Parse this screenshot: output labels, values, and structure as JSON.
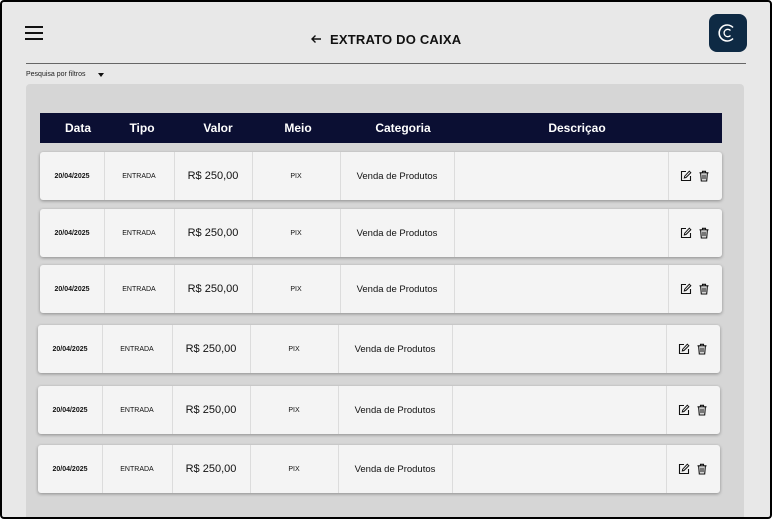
{
  "header": {
    "title": "EXTRATO DO CAIXA",
    "menu_icon": "hamburger-menu-icon",
    "back_icon": "arrow-left-icon",
    "logo_color": "#0e2a44"
  },
  "filter": {
    "label": "Pesquisa por filtros",
    "icon": "caret-down-icon"
  },
  "table": {
    "header_color": "#0b0f33",
    "columns": [
      "Data",
      "Tipo",
      "Valor",
      "Meio",
      "Categoria",
      "Descriçao"
    ],
    "rows": [
      {
        "data": "20/04/2025",
        "tipo": "ENTRADA",
        "valor": "R$ 250,00",
        "meio": "PIX",
        "categoria": "Venda de Produtos",
        "descricao": ""
      },
      {
        "data": "20/04/2025",
        "tipo": "ENTRADA",
        "valor": "R$ 250,00",
        "meio": "PIX",
        "categoria": "Venda de Produtos",
        "descricao": ""
      },
      {
        "data": "20/04/2025",
        "tipo": "ENTRADA",
        "valor": "R$ 250,00",
        "meio": "PIX",
        "categoria": "Venda de Produtos",
        "descricao": ""
      },
      {
        "data": "20/04/2025",
        "tipo": "ENTRADA",
        "valor": "R$ 250,00",
        "meio": "PIX",
        "categoria": "Venda de Produtos",
        "descricao": ""
      },
      {
        "data": "20/04/2025",
        "tipo": "ENTRADA",
        "valor": "R$ 250,00",
        "meio": "PIX",
        "categoria": "Venda de Produtos",
        "descricao": ""
      },
      {
        "data": "20/04/2025",
        "tipo": "ENTRADA",
        "valor": "R$ 250,00",
        "meio": "PIX",
        "categoria": "Venda de Produtos",
        "descricao": ""
      }
    ],
    "row_actions": [
      "edit-icon",
      "trash-icon"
    ]
  }
}
